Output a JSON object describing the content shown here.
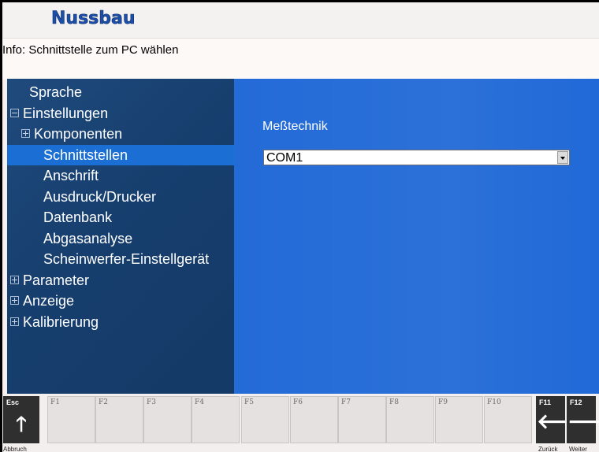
{
  "header": {
    "logo_text": "Nussbaum"
  },
  "info": {
    "text": "Info: Schnittstelle zum PC wählen"
  },
  "tree": {
    "items": [
      {
        "label": "Sprache",
        "indent": 0,
        "expander": "none",
        "selected": false
      },
      {
        "label": "Einstellungen",
        "indent": 0,
        "expander": "minus",
        "selected": false
      },
      {
        "label": "Komponenten",
        "indent": 1,
        "expander": "plus",
        "selected": false
      },
      {
        "label": "Schnittstellen",
        "indent": 2,
        "expander": "none",
        "selected": true
      },
      {
        "label": "Anschrift",
        "indent": 2,
        "expander": "none",
        "selected": false
      },
      {
        "label": "Ausdruck/Drucker",
        "indent": 2,
        "expander": "none",
        "selected": false
      },
      {
        "label": "Datenbank",
        "indent": 2,
        "expander": "none",
        "selected": false
      },
      {
        "label": "Abgasanalyse",
        "indent": 2,
        "expander": "none",
        "selected": false
      },
      {
        "label": "Scheinwerfer-Einstellgerät",
        "indent": 2,
        "expander": "none",
        "selected": false
      },
      {
        "label": "Parameter",
        "indent": 0,
        "expander": "plus",
        "selected": false
      },
      {
        "label": "Anzeige",
        "indent": 0,
        "expander": "plus",
        "selected": false
      },
      {
        "label": "Kalibrierung",
        "indent": 0,
        "expander": "plus",
        "selected": false
      }
    ]
  },
  "settings": {
    "field_label": "Meßtechnik",
    "select_value": "COM1"
  },
  "fkeys": [
    {
      "key": "Esc",
      "icon": "arrow-up-icon",
      "glyph": "🡑",
      "dark": true,
      "caption": "Abbruch"
    },
    {
      "key": "F1",
      "dark": false
    },
    {
      "key": "F2",
      "dark": false
    },
    {
      "key": "F3",
      "dark": false
    },
    {
      "key": "F4",
      "dark": false
    },
    {
      "key": "F5",
      "dark": false
    },
    {
      "key": "F6",
      "dark": false
    },
    {
      "key": "F7",
      "dark": false
    },
    {
      "key": "F8",
      "dark": false
    },
    {
      "key": "F9",
      "dark": false
    },
    {
      "key": "F10",
      "dark": false
    },
    {
      "key": "F11",
      "icon": "arrow-left-icon",
      "glyph": "🡐",
      "dark": true,
      "caption": "Zurück"
    },
    {
      "key": "F12",
      "icon": "arrow-right-icon",
      "glyph": "🡒",
      "dark": true,
      "caption": "Weiter"
    }
  ],
  "colors": {
    "tree_bg": "#173f6e",
    "tree_selected": "#1b6fd4",
    "content_bg": "#1c66d6",
    "logo": "#1c4fa8"
  }
}
